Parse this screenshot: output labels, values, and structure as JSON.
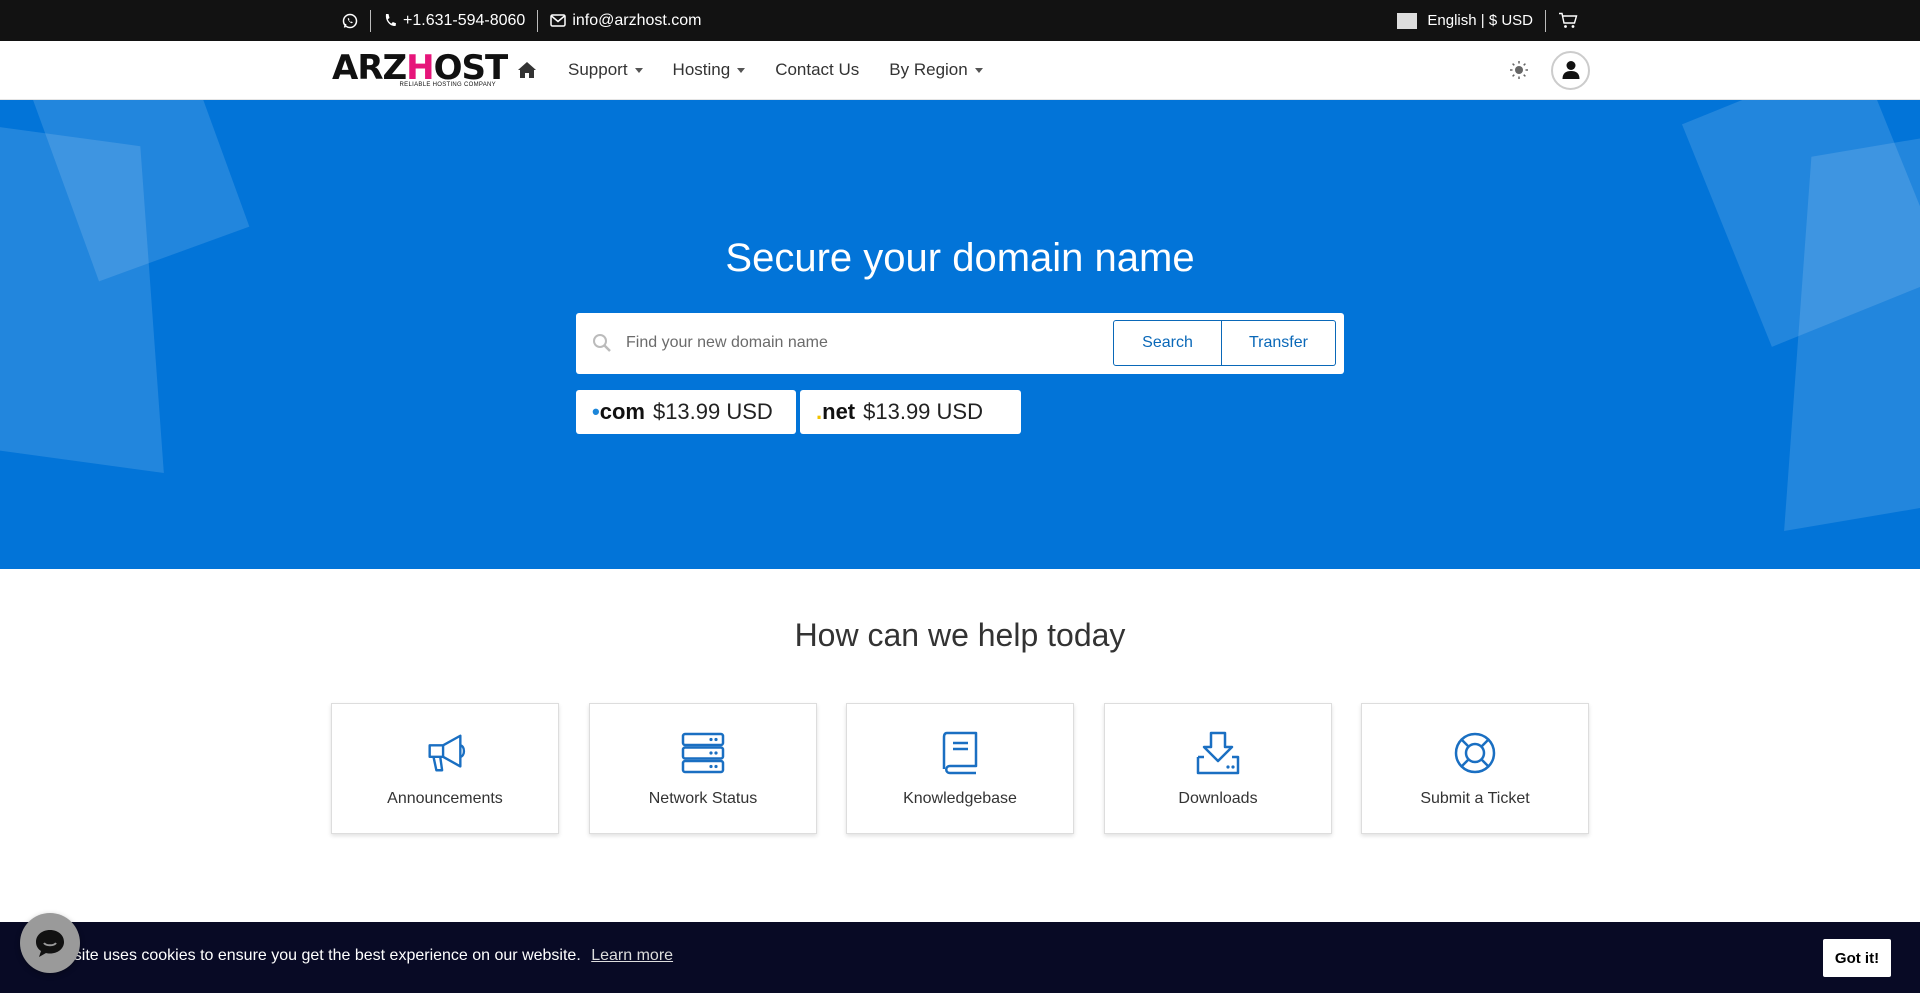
{
  "topbar": {
    "whatsapp_icon": "whatsapp-icon",
    "phone": "+1.631-594-8060",
    "email": "info@arzhost.com",
    "language_currency": "English | $ USD",
    "cart_icon": "cart-icon"
  },
  "nav": {
    "logo": {
      "part1": "ARZ",
      "part2": "H",
      "part3": "OST",
      "tagline": "RELIABLE HOSTING COMPANY"
    },
    "items": [
      {
        "label": "Support",
        "dropdown": true
      },
      {
        "label": "Hosting",
        "dropdown": true
      },
      {
        "label": "Contact Us",
        "dropdown": false
      },
      {
        "label": "By Region",
        "dropdown": true
      }
    ]
  },
  "hero": {
    "title": "Secure your domain name",
    "search_placeholder": "Find your new domain name",
    "search_button": "Search",
    "transfer_button": "Transfer",
    "tlds": [
      {
        "name": "com",
        "price": "$13.99 USD"
      },
      {
        "name": "net",
        "price": "$13.99 USD"
      }
    ]
  },
  "help": {
    "title": "How can we help today",
    "cards": [
      {
        "label": "Announcements",
        "icon": "megaphone-icon"
      },
      {
        "label": "Network Status",
        "icon": "server-icon"
      },
      {
        "label": "Knowledgebase",
        "icon": "book-icon"
      },
      {
        "label": "Downloads",
        "icon": "download-icon"
      },
      {
        "label": "Submit a Ticket",
        "icon": "lifebuoy-icon"
      }
    ]
  },
  "cookie": {
    "text": "ebsite uses cookies to ensure you get the best experience on our website.",
    "learn_more": "Learn more",
    "button": "Got it!"
  },
  "colors": {
    "hero_bg": "#0274d8",
    "accent": "#0a68b8",
    "logo_pink": "#e6157a",
    "topbar_bg": "#121212",
    "cookie_bg": "#080a25"
  }
}
